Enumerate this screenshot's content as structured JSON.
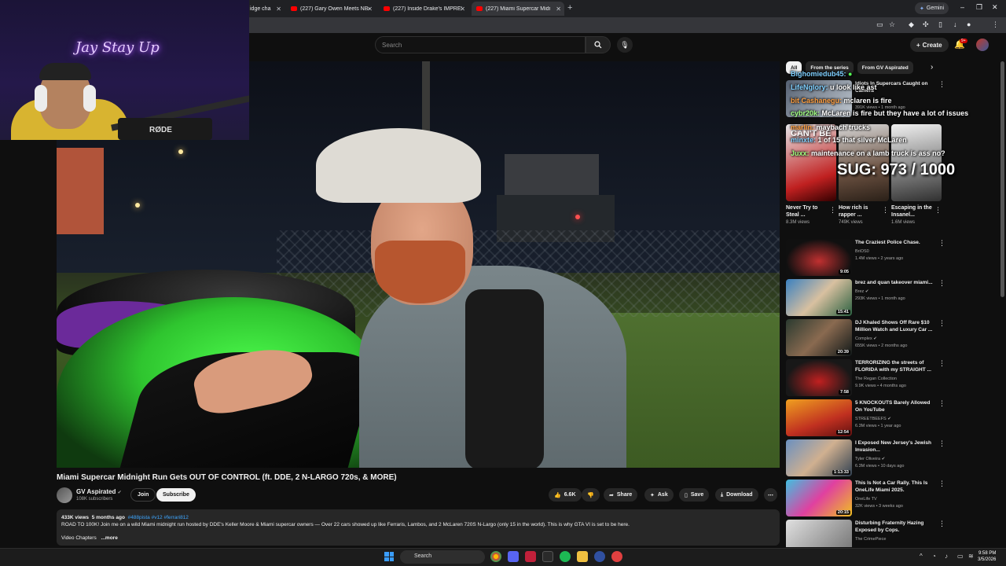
{
  "browser": {
    "tabs": [
      {
        "label": "idge cha"
      },
      {
        "label": "(227) Gary Owen Meets NBA Y"
      },
      {
        "label": "(227) Inside Drake's IMPRESSIV"
      },
      {
        "label": "(227) Miami Supercar Midn"
      }
    ],
    "gemini_label": "Gemini"
  },
  "masthead": {
    "search_placeholder": "Search",
    "create_label": "Create",
    "notif_count": "9+"
  },
  "webcam": {
    "neon_sign": "Jay Stay Up",
    "mic_brand": "RØDE"
  },
  "video": {
    "title": "Miami Supercar Midnight Run Gets OUT OF CONTROL (ft. DDE, 2 N-LARGO 720s, & MORE)",
    "channel": {
      "name": "GV Aspirated",
      "subscribers": "108K subscribers",
      "join_label": "Join",
      "subscribe_label": "Subscribe"
    },
    "actions": {
      "likes": "6.6K",
      "share": "Share",
      "ask": "Ask",
      "save": "Save",
      "download": "Download"
    },
    "description": {
      "views": "433K views",
      "age": "5 months ago",
      "tags": "#488pista #v12 #ferrari812",
      "text": "ROAD TO 100K! Join me on a wild Miami midnight run hosted by DDE's Keller Moore & Miami supercar owners — Over 22 cars showed up like Ferraris, Lambos, and 2 McLaren 720S N-Largo (only 15 in the world). This is why GTA VI is set to be here.",
      "chapters": "Video Chapters",
      "more": "...more"
    }
  },
  "sidebar": {
    "chips": [
      {
        "label": "All"
      },
      {
        "label": "From the series"
      },
      {
        "label": "From GV Aspirated"
      }
    ],
    "top_item": {
      "title": "Idiots In Supercars Caught on Camera",
      "views": "391K views",
      "age": "1 month ago"
    },
    "shorts": [
      {
        "title": "Never Try to Steal ...",
        "views": "8.3M views",
        "overlay": "CAN'T BE"
      },
      {
        "title": "How rich is rapper ...",
        "views": "749K views",
        "overlay": ""
      },
      {
        "title": "Escaping in the Insanel...",
        "views": "1.6M views",
        "overlay": ""
      }
    ],
    "recs": [
      {
        "title": "The Craziest Police Chase.",
        "channel": "BriOS0",
        "meta": "1.4M views • 2 years ago",
        "duration": "9:05"
      },
      {
        "title": "brez and quan takeover miami...",
        "channel": "Brez",
        "meta": "293K views • 1 month ago",
        "duration": "15:41"
      },
      {
        "title": "DJ Khaled Shows Off Rare $10 Million Watch and Luxury Car ...",
        "channel": "Complex",
        "meta": "655K views • 2 months ago",
        "duration": "20:39"
      },
      {
        "title": "TERRORIZING the streets of FLORIDA with my STRAIGHT ...",
        "channel": "The Regan Collection",
        "meta": "9.9K views • 4 months ago",
        "duration": "7:58"
      },
      {
        "title": "5 KNOCKOUTS Barely Allowed On YouTube",
        "channel": "STREETBEEFS",
        "meta": "6.3M views • 1 year ago",
        "duration": "12:54"
      },
      {
        "title": "I Exposed New Jersey's Jewish Invasion...",
        "channel": "Tyler Oliveira",
        "meta": "6.3M views • 10 days ago",
        "duration": "1:13:33"
      },
      {
        "title": "This Is Not a Car Rally. This Is OneLife Miami 2025.",
        "channel": "OneLife TV",
        "meta": "32K views • 3 weeks ago",
        "duration": "20:15"
      },
      {
        "title": "Disturbing Fraternity Hazing Exposed by Cops.",
        "channel": "The CrimePiece",
        "meta": "",
        "duration": ""
      }
    ]
  },
  "chat_overlay": {
    "messages": [
      {
        "user": "Bighomiedub45:",
        "text": ""
      },
      {
        "user": "LifeNglory:",
        "text": "u look like ast"
      },
      {
        "user": "bit Cashanegu:",
        "text": "mclaren is fire"
      },
      {
        "user": "cybr20k:",
        "text": "McLaren is fire but they have a lot of issues"
      },
      {
        "user": "marlin:",
        "text": "maybach trucks"
      },
      {
        "user": "minxte:",
        "text": "1 of 15 that silver McLaren"
      },
      {
        "user": "Juxx:",
        "text": "maintenance on a lamb truck is ass no?"
      }
    ],
    "goal": "SUG: 973 / 1000"
  },
  "taskbar": {
    "search_label": "Search",
    "time": "9:58 PM",
    "date": "3/5/2026"
  }
}
